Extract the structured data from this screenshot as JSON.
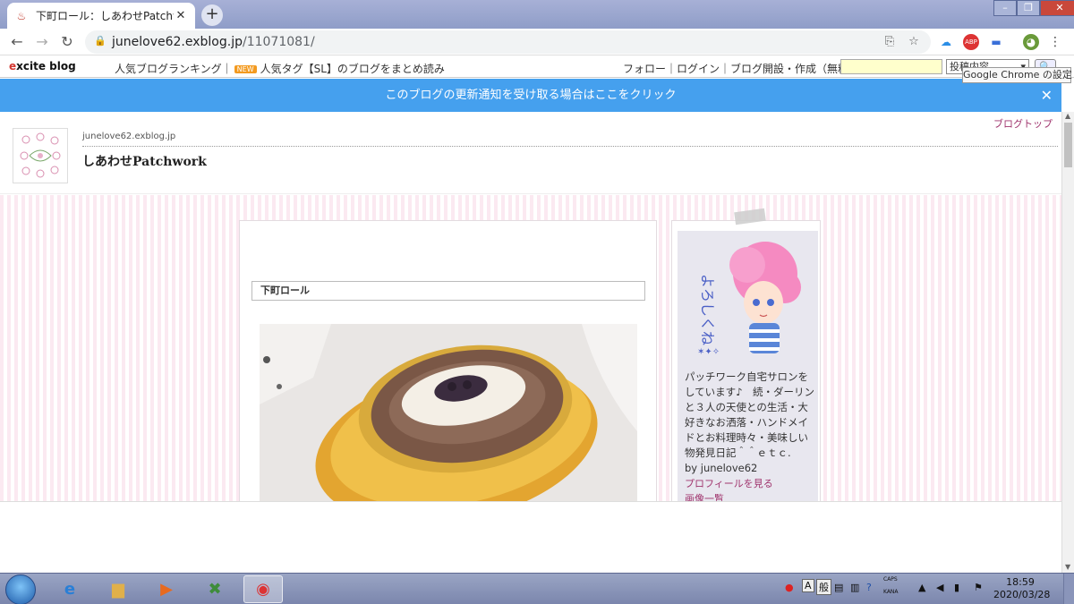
{
  "browser": {
    "tab_title": "下町ロール：しあわせPatchwor",
    "tab_close": "✕",
    "new_tab": "+",
    "url_domain": "junelove62.exblog.jp",
    "url_path": "/11071081/",
    "tooltip": "Google Chrome の設定"
  },
  "excite": {
    "logo_e": "e",
    "logo_rest": "xcite blog",
    "ranking": "人気ブログランキング｜",
    "new_badge": "NEW",
    "tag_text": "人気タグ【SL】のブログをまとめ読み",
    "top_links": "フォロー｜ログイン｜ブログ開設・作成（無料）",
    "search_select": "投稿内容"
  },
  "notify": {
    "text": "このブログの更新通知を受け取る場合はここをクリック",
    "close": "✕"
  },
  "blog": {
    "top_link": "ブログトップ",
    "domain": "junelove62.exblog.jp",
    "title": "しあわせPatchwork"
  },
  "post": {
    "title": "下町ロール"
  },
  "sidebar": {
    "profile_text": "パッチワーク自宅サロンをしています♪　続・ダーリンと３人の天使との生活・大好きなお洒落・ハンドメイドとお料理時々・美味しい物発見日記＾＾ｅｔｃ.",
    "by_line": "by junelove62",
    "profile_link": "プロフィールを見る",
    "images_link": "画像一覧"
  },
  "taskbar": {
    "clock_time": "18:59",
    "clock_date": "2020/03/28",
    "ime_a": "A",
    "ime_mode": "般",
    "caps": "CAPS",
    "kana": "KANA"
  },
  "colors": {
    "notify_blue": "#45a0ee",
    "link_magenta": "#a0356e",
    "stripe_pink": "#fbe9f1"
  }
}
